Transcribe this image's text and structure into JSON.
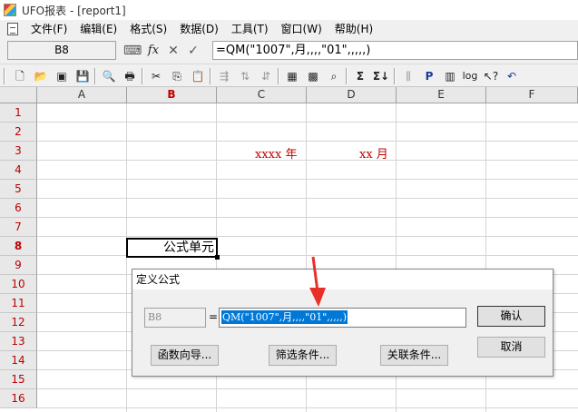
{
  "window": {
    "title": "UFO报表 - [report1]"
  },
  "menu": {
    "items": [
      "文件(F)",
      "编辑(E)",
      "格式(S)",
      "数据(D)",
      "工具(T)",
      "窗口(W)",
      "帮助(H)"
    ]
  },
  "formula_bar": {
    "cell_ref": "B8",
    "fx_icon": "fx",
    "formula": "=QM(\"1007\",月,,,,\"01\",,,,,)"
  },
  "grid": {
    "columns": [
      "A",
      "B",
      "C",
      "D",
      "E",
      "F"
    ],
    "selected_column": "B",
    "rows": [
      "1",
      "2",
      "3",
      "4",
      "5",
      "6",
      "7",
      "8",
      "9",
      "10",
      "11",
      "12",
      "13",
      "14",
      "15",
      "16"
    ],
    "selected_row": "8",
    "cells": {
      "c3_text": "xxxx 年",
      "d3_text": "xx 月",
      "b8_text": "公式单元"
    }
  },
  "dialog": {
    "title": "定义公式",
    "cell_ref": "B8",
    "equals": "=",
    "formula": "QM(\"1007\",月,,,,\"01\",,,,,)",
    "buttons": {
      "confirm": "确认",
      "cancel": "取消",
      "function_wizard": "函数向导...",
      "filter_condition": "筛选条件...",
      "relation_condition": "关联条件..."
    }
  },
  "colors": {
    "red_text": "#c00000",
    "selection_blue": "#0078d7",
    "annotation_arrow": "#e8302a"
  }
}
